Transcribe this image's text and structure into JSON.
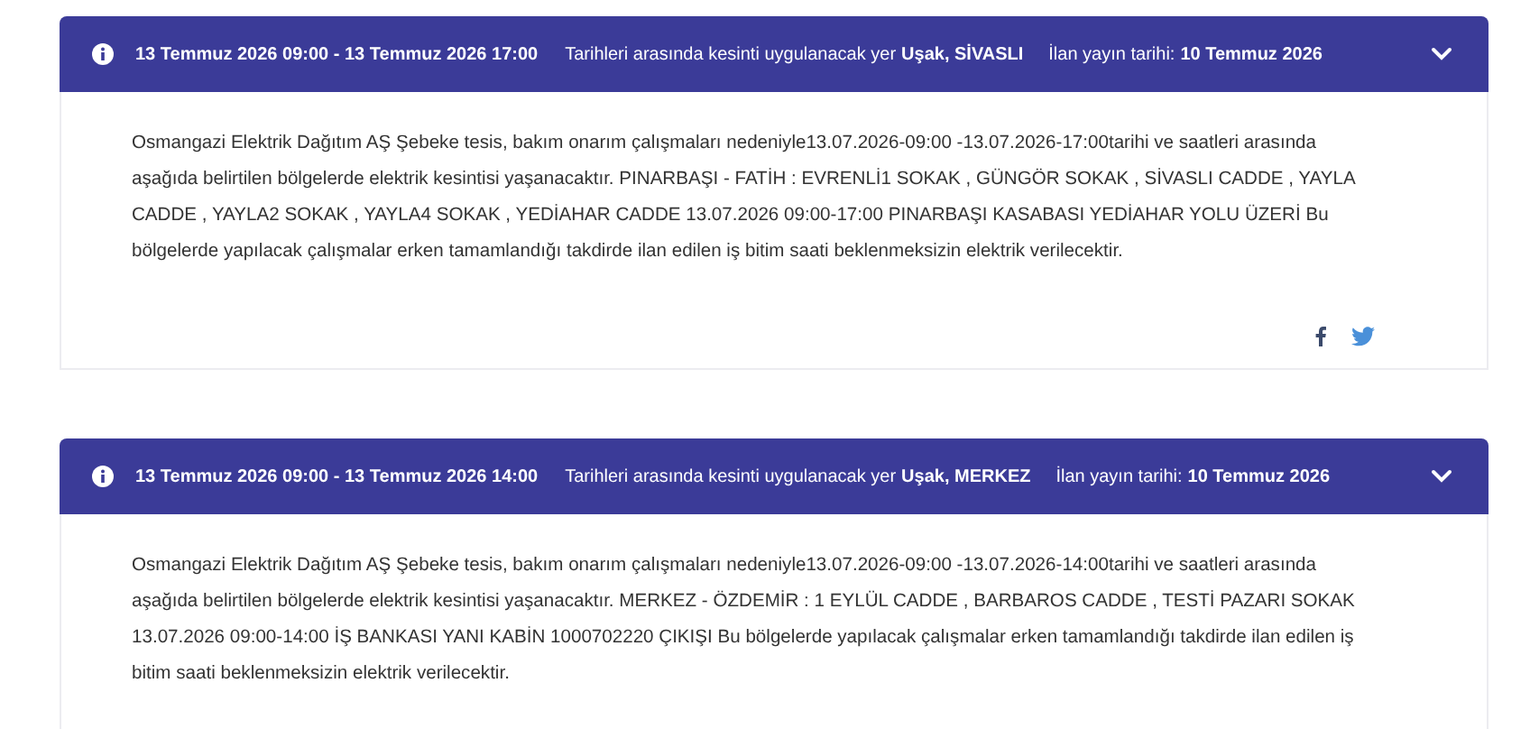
{
  "notices": [
    {
      "dates": "13 Temmuz 2026 09:00 - 13 Temmuz 2026 17:00",
      "location_label": "Tarihleri arasında kesinti uygulanacak yer",
      "location": "Uşak, SİVASLI",
      "publish_label": "İlan yayın tarihi:",
      "publish_date": "10 Temmuz 2026",
      "expanded": true,
      "description": "Osmangazi Elektrik Dağıtım AŞ Şebeke tesis, bakım onarım çalışmaları nedeniyle13.07.2026-09:00 -13.07.2026-17:00tarihi ve saatleri arasında aşağıda belirtilen bölgelerde elektrik kesintisi yaşanacaktır. PINARBAŞI - FATİH : EVRENLİ1 SOKAK , GÜNGÖR SOKAK , SİVASLI CADDE , YAYLA CADDE , YAYLA2 SOKAK , YAYLA4 SOKAK , YEDİAHAR CADDE 13.07.2026 09:00-17:00 PINARBAŞI KASABASI YEDİAHAR YOLU ÜZERİ Bu bölgelerde yapılacak çalışmalar erken tamamlandığı takdirde ilan edilen iş bitim saati beklenmeksizin elektrik verilecektir.",
      "share": [
        {
          "kind": "facebook"
        },
        {
          "kind": "twitter"
        }
      ]
    },
    {
      "dates": "13 Temmuz 2026 09:00 - 13 Temmuz 2026 14:00",
      "location_label": "Tarihleri arasında kesinti uygulanacak yer",
      "location": "Uşak, MERKEZ",
      "publish_label": "İlan yayın tarihi:",
      "publish_date": "10 Temmuz 2026",
      "expanded": true,
      "description": "Osmangazi Elektrik Dağıtım AŞ Şebeke tesis, bakım onarım çalışmaları nedeniyle13.07.2026-09:00 -13.07.2026-14:00tarihi ve saatleri arasında aşağıda belirtilen bölgelerde elektrik kesintisi yaşanacaktır. MERKEZ - ÖZDEMİR : 1 EYLÜL CADDE , BARBAROS CADDE , TESTİ PAZARI SOKAK 13.07.2026 09:00-14:00 İŞ BANKASI YANI KABİN 1000702220 ÇIKIŞI Bu bölgelerde yapılacak çalışmalar erken tamamlandığı takdirde ilan edilen iş bitim saati beklenmeksizin elektrik verilecektir."
    }
  ]
}
